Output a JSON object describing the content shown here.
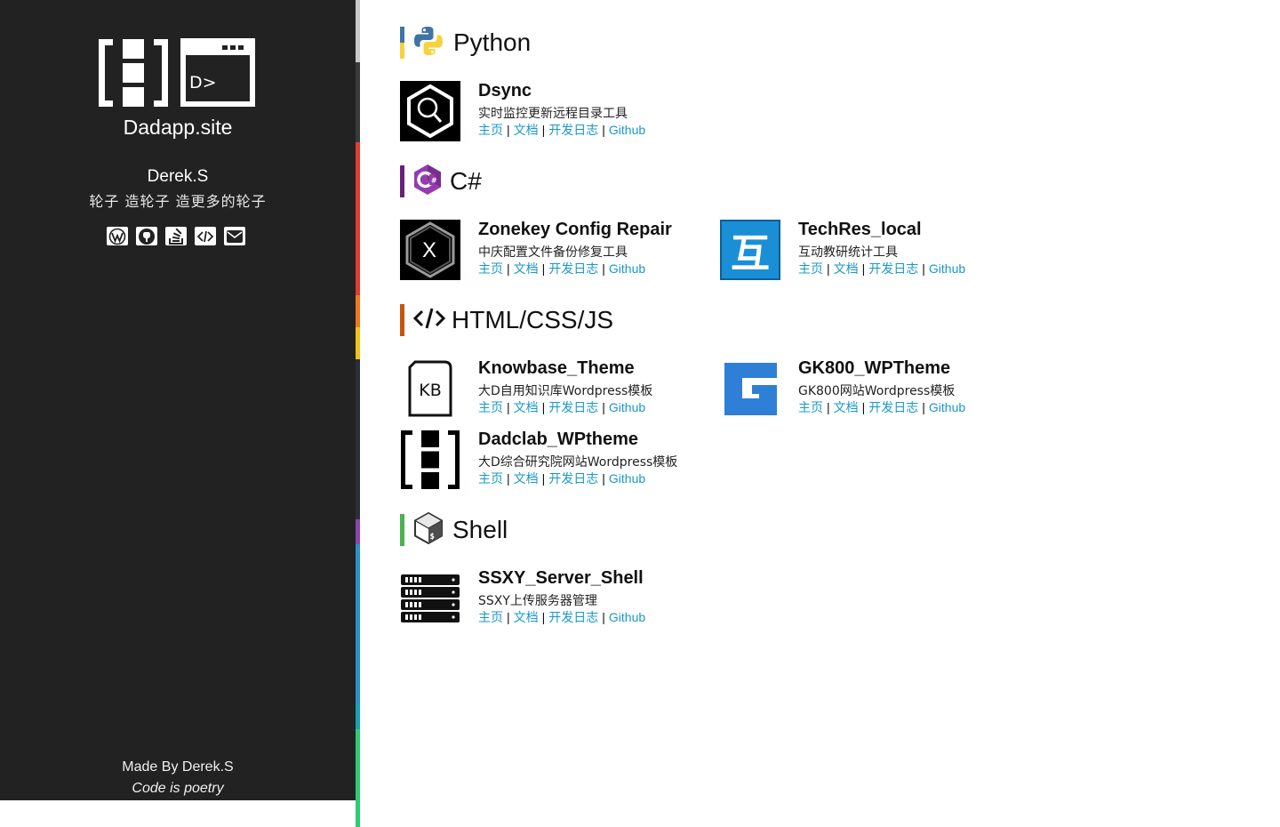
{
  "sidebar": {
    "site_name": "Dadapp.site",
    "author": "Derek.S",
    "tagline": "轮子 造轮子 造更多的轮子",
    "social": [
      "wordpress-icon",
      "github-icon",
      "stack-overflow-icon",
      "code-icon",
      "mail-icon"
    ],
    "footer_made": "Made By Derek.S",
    "footer_poetry": "Code is poetry"
  },
  "link_labels": {
    "home": "主页",
    "docs": "文档",
    "changelog": "开发日志",
    "github": "Github",
    "sep": "|"
  },
  "sections": {
    "python": {
      "title": "Python",
      "accent": "#3f74a6"
    },
    "csharp": {
      "title": "C#",
      "accent": "#68217a"
    },
    "web": {
      "title": "HTML/CSS/JS",
      "accent": "#c4560c"
    },
    "shell": {
      "title": "Shell",
      "accent": "#4caf50"
    }
  },
  "projects": {
    "dsync": {
      "title": "Dsync",
      "desc": "实时监控更新远程目录工具"
    },
    "zonekey": {
      "title": "Zonekey Config Repair",
      "desc": "中庆配置文件备份修复工具"
    },
    "techres": {
      "title": "TechRes_local",
      "desc": "互动教研统计工具",
      "icon_text": "互"
    },
    "knowbase": {
      "title": "Knowbase_Theme",
      "desc": "大D自用知识库Wordpress模板",
      "icon_text": "KB"
    },
    "gk800": {
      "title": "GK800_WPTheme",
      "desc": "GK800网站Wordpress模板"
    },
    "dadclab": {
      "title": "Dadclab_WPtheme",
      "desc": "大D综合研究院网站Wordpress模板"
    },
    "ssxy": {
      "title": "SSXY_Server_Shell",
      "desc": "SSXY上传服务器管理"
    }
  },
  "colors": {
    "sidebar_bg": "#222222",
    "link": "#1a98c8",
    "techres_blue": "#1a8fd6",
    "gk800_blue": "#2f7fd6"
  }
}
